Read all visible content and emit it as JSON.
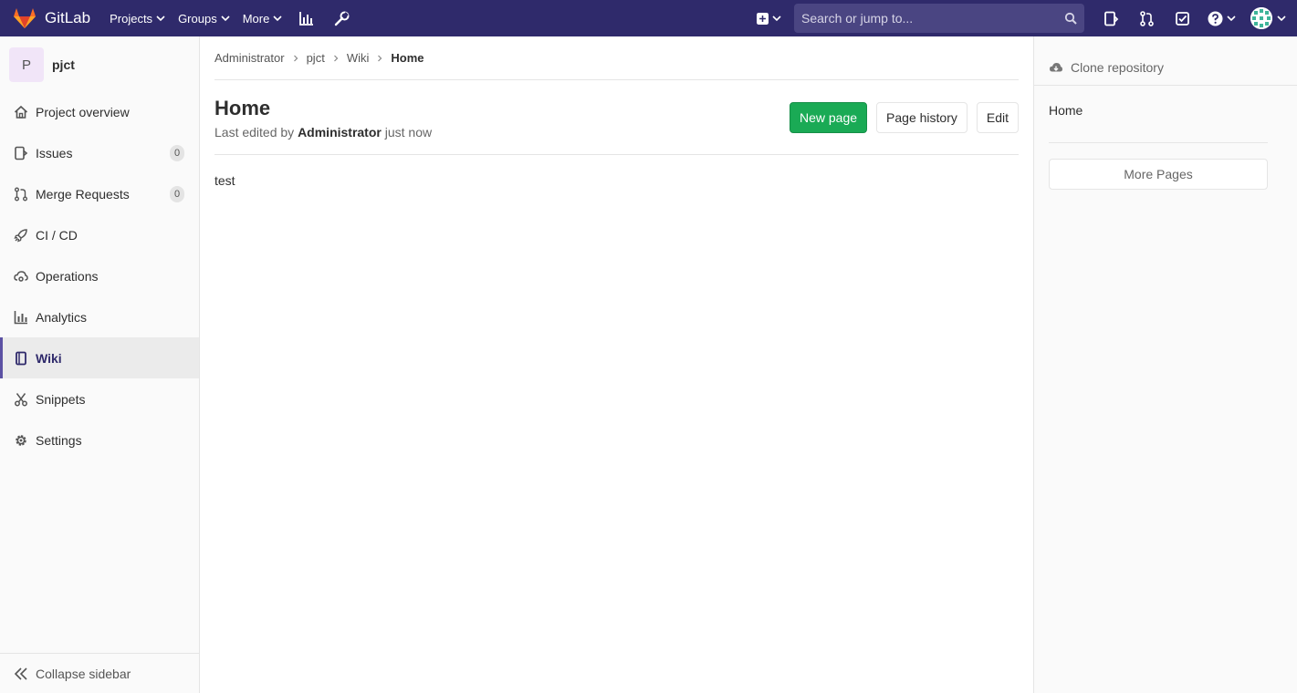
{
  "navbar": {
    "brand": "GitLab",
    "items": [
      {
        "label": "Projects"
      },
      {
        "label": "Groups"
      },
      {
        "label": "More"
      }
    ],
    "search_placeholder": "Search or jump to...",
    "bg_color": "#2f2a6b"
  },
  "project": {
    "initial": "P",
    "name": "pjct"
  },
  "sidebar": {
    "items": [
      {
        "label": "Project overview",
        "icon": "home-icon"
      },
      {
        "label": "Issues",
        "icon": "issues-icon",
        "badge": "0"
      },
      {
        "label": "Merge Requests",
        "icon": "merge-request-icon",
        "badge": "0"
      },
      {
        "label": "CI / CD",
        "icon": "rocket-icon"
      },
      {
        "label": "Operations",
        "icon": "cloud-gear-icon"
      },
      {
        "label": "Analytics",
        "icon": "chart-icon"
      },
      {
        "label": "Wiki",
        "icon": "book-icon",
        "active": true
      },
      {
        "label": "Snippets",
        "icon": "scissors-icon"
      },
      {
        "label": "Settings",
        "icon": "gear-icon"
      }
    ],
    "collapse_label": "Collapse sidebar"
  },
  "breadcrumb": [
    "Administrator",
    "pjct",
    "Wiki",
    "Home"
  ],
  "wiki": {
    "title": "Home",
    "meta_prefix": "Last edited by",
    "meta_author": "Administrator",
    "meta_time": "just now",
    "content": "test",
    "buttons": {
      "new_page": "New page",
      "page_history": "Page history",
      "edit": "Edit"
    },
    "accent_color": "#1aaa55"
  },
  "right_sidebar": {
    "clone_label": "Clone repository",
    "home_link": "Home",
    "more_pages": "More Pages"
  }
}
